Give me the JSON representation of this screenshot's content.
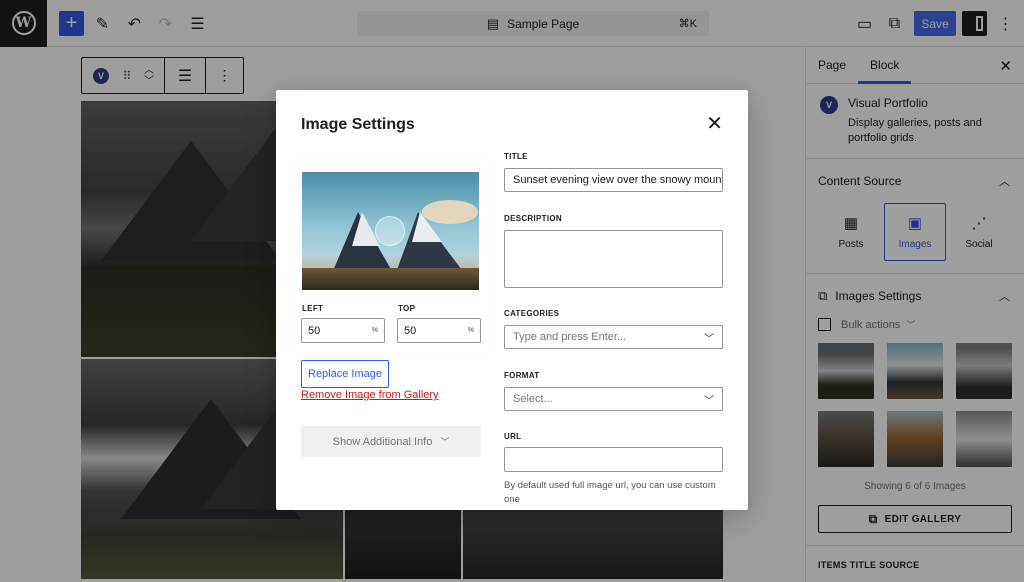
{
  "topbar": {
    "document_title": "Sample Page",
    "shortcut": "⌘K",
    "save_label": "Save"
  },
  "sidebar": {
    "tabs": [
      {
        "label": "Page"
      },
      {
        "label": "Block"
      }
    ],
    "block": {
      "logo_letter": "V",
      "title": "Visual Portfolio",
      "description": "Display galleries, posts and portfolio grids."
    },
    "content_source": {
      "title": "Content Source",
      "options": [
        {
          "label": "Posts",
          "icon": "posts-icon"
        },
        {
          "label": "Images",
          "icon": "images-icon"
        },
        {
          "label": "Social",
          "icon": "share-icon"
        }
      ]
    },
    "images_settings": {
      "title": "Images Settings",
      "bulk_actions": "Bulk actions",
      "showing": "Showing 6 of 6 Images",
      "edit_gallery": "EDIT GALLERY"
    },
    "items_title_source": "ITEMS TITLE SOURCE"
  },
  "canvas": {
    "block_logo_letter": "V"
  },
  "modal": {
    "title": "Image Settings",
    "focal": {
      "left_label": "LEFT",
      "left_value": "50",
      "top_label": "TOP",
      "top_value": "50",
      "unit": "%"
    },
    "replace_label": "Replace Image",
    "remove_label": "Remove Image from Gallery",
    "additional_label": "Show Additional Info",
    "fields": {
      "title_label": "TITLE",
      "title_value": "Sunset evening view over the snowy mount",
      "description_label": "DESCRIPTION",
      "categories_label": "CATEGORIES",
      "categories_placeholder": "Type and press Enter...",
      "format_label": "FORMAT",
      "format_placeholder": "Select...",
      "url_label": "URL",
      "url_help": "By default used full image url, you can use custom one"
    }
  }
}
